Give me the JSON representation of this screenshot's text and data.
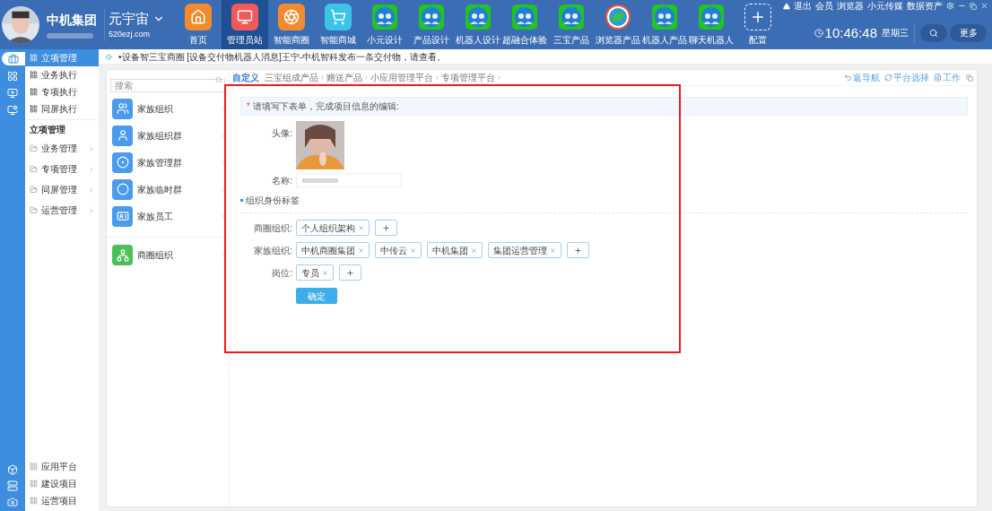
{
  "brand": {
    "name": "中机集团",
    "product": "元宇宙",
    "domain": "520ezj.com"
  },
  "nav": [
    {
      "label": "首页",
      "kind": "home",
      "color": "#f28a2e",
      "selected": false
    },
    {
      "label": "管理员站",
      "kind": "monitor",
      "color": "#f25a5a",
      "selected": true
    },
    {
      "label": "智能商圈",
      "kind": "aperture",
      "color": "#f28a2e",
      "selected": false
    },
    {
      "label": "智能商城",
      "kind": "cart",
      "color": "#3cc4e8",
      "selected": false
    },
    {
      "label": "小元设计",
      "kind": "globe",
      "color": "#22c322",
      "selected": false
    },
    {
      "label": "产品设计",
      "kind": "globe",
      "color": "#22c322",
      "selected": false
    },
    {
      "label": "机器人设计",
      "kind": "globe",
      "color": "#22c322",
      "selected": false
    },
    {
      "label": "超融合体验",
      "kind": "globe",
      "color": "#22c322",
      "selected": false
    },
    {
      "label": "三宝产品",
      "kind": "globe",
      "color": "#22c322",
      "selected": false
    },
    {
      "label": "浏览器产品",
      "kind": "swirl",
      "selected": false
    },
    {
      "label": "机器人产品",
      "kind": "globe",
      "color": "#22c322",
      "selected": false
    },
    {
      "label": "聊天机器人",
      "kind": "globe",
      "color": "#22c322",
      "selected": false
    },
    {
      "label": "配置",
      "kind": "plus",
      "selected": false
    }
  ],
  "top_links": [
    "退出",
    "会员",
    "浏览器",
    "小元传媒",
    "数据资产"
  ],
  "clock": {
    "time": "10:46:48",
    "weekday": "星期三"
  },
  "more_button": "更多",
  "sidebar": {
    "items": [
      {
        "label": "立项管理",
        "selected": true
      },
      {
        "label": "业务执行",
        "selected": false
      },
      {
        "label": "专项执行",
        "selected": false
      },
      {
        "label": "同屏执行",
        "selected": false
      }
    ],
    "section": "立项管理",
    "groups": [
      "业务管理",
      "专项管理",
      "同屏管理",
      "运营管理"
    ],
    "bottom": [
      "应用平台",
      "建设项目",
      "运营项目"
    ]
  },
  "ticker": "•设备智三宝商圈 [设备交付物机器人消息]王宁-中机智科发布一条交付物，请查看。",
  "org_list": {
    "placeholder": "搜索",
    "items": [
      {
        "label": "家族组织",
        "kind": "people",
        "color": "#4a9af0"
      },
      {
        "label": "家族组织群",
        "kind": "person",
        "color": "#4a9af0"
      },
      {
        "label": "家族管理群",
        "kind": "ring",
        "color": "#4a9af0"
      },
      {
        "label": "家族临时群",
        "kind": "circle",
        "color": "#4a9af0"
      },
      {
        "label": "家族员工",
        "kind": "badge",
        "color": "#4a9af0"
      },
      {
        "label": "商圈组织",
        "kind": "tree",
        "color": "#4cbf5a"
      }
    ]
  },
  "breadcrumb": {
    "root": "自定义",
    "items": [
      "三宝组成产品",
      "赠送产品",
      "小应用管理平台",
      "专项管理平台"
    ]
  },
  "actions": [
    "返导航",
    "平台选择",
    "工作"
  ],
  "form": {
    "required_mark": "*",
    "notice": "请填写下表单，完成项目信息的编辑:",
    "avatar_label": "头像:",
    "name_label": "名称:",
    "section": "组织身份标签",
    "tag_rows": [
      {
        "label": "商圈组织:",
        "tags": [
          "个人组织架构"
        ]
      },
      {
        "label": "家族组织:",
        "tags": [
          "中机商圈集团",
          "中传云",
          "中机集团",
          "集团运营管理"
        ]
      },
      {
        "label": "岗位:",
        "tags": [
          "专员"
        ]
      }
    ],
    "submit": "确定"
  }
}
